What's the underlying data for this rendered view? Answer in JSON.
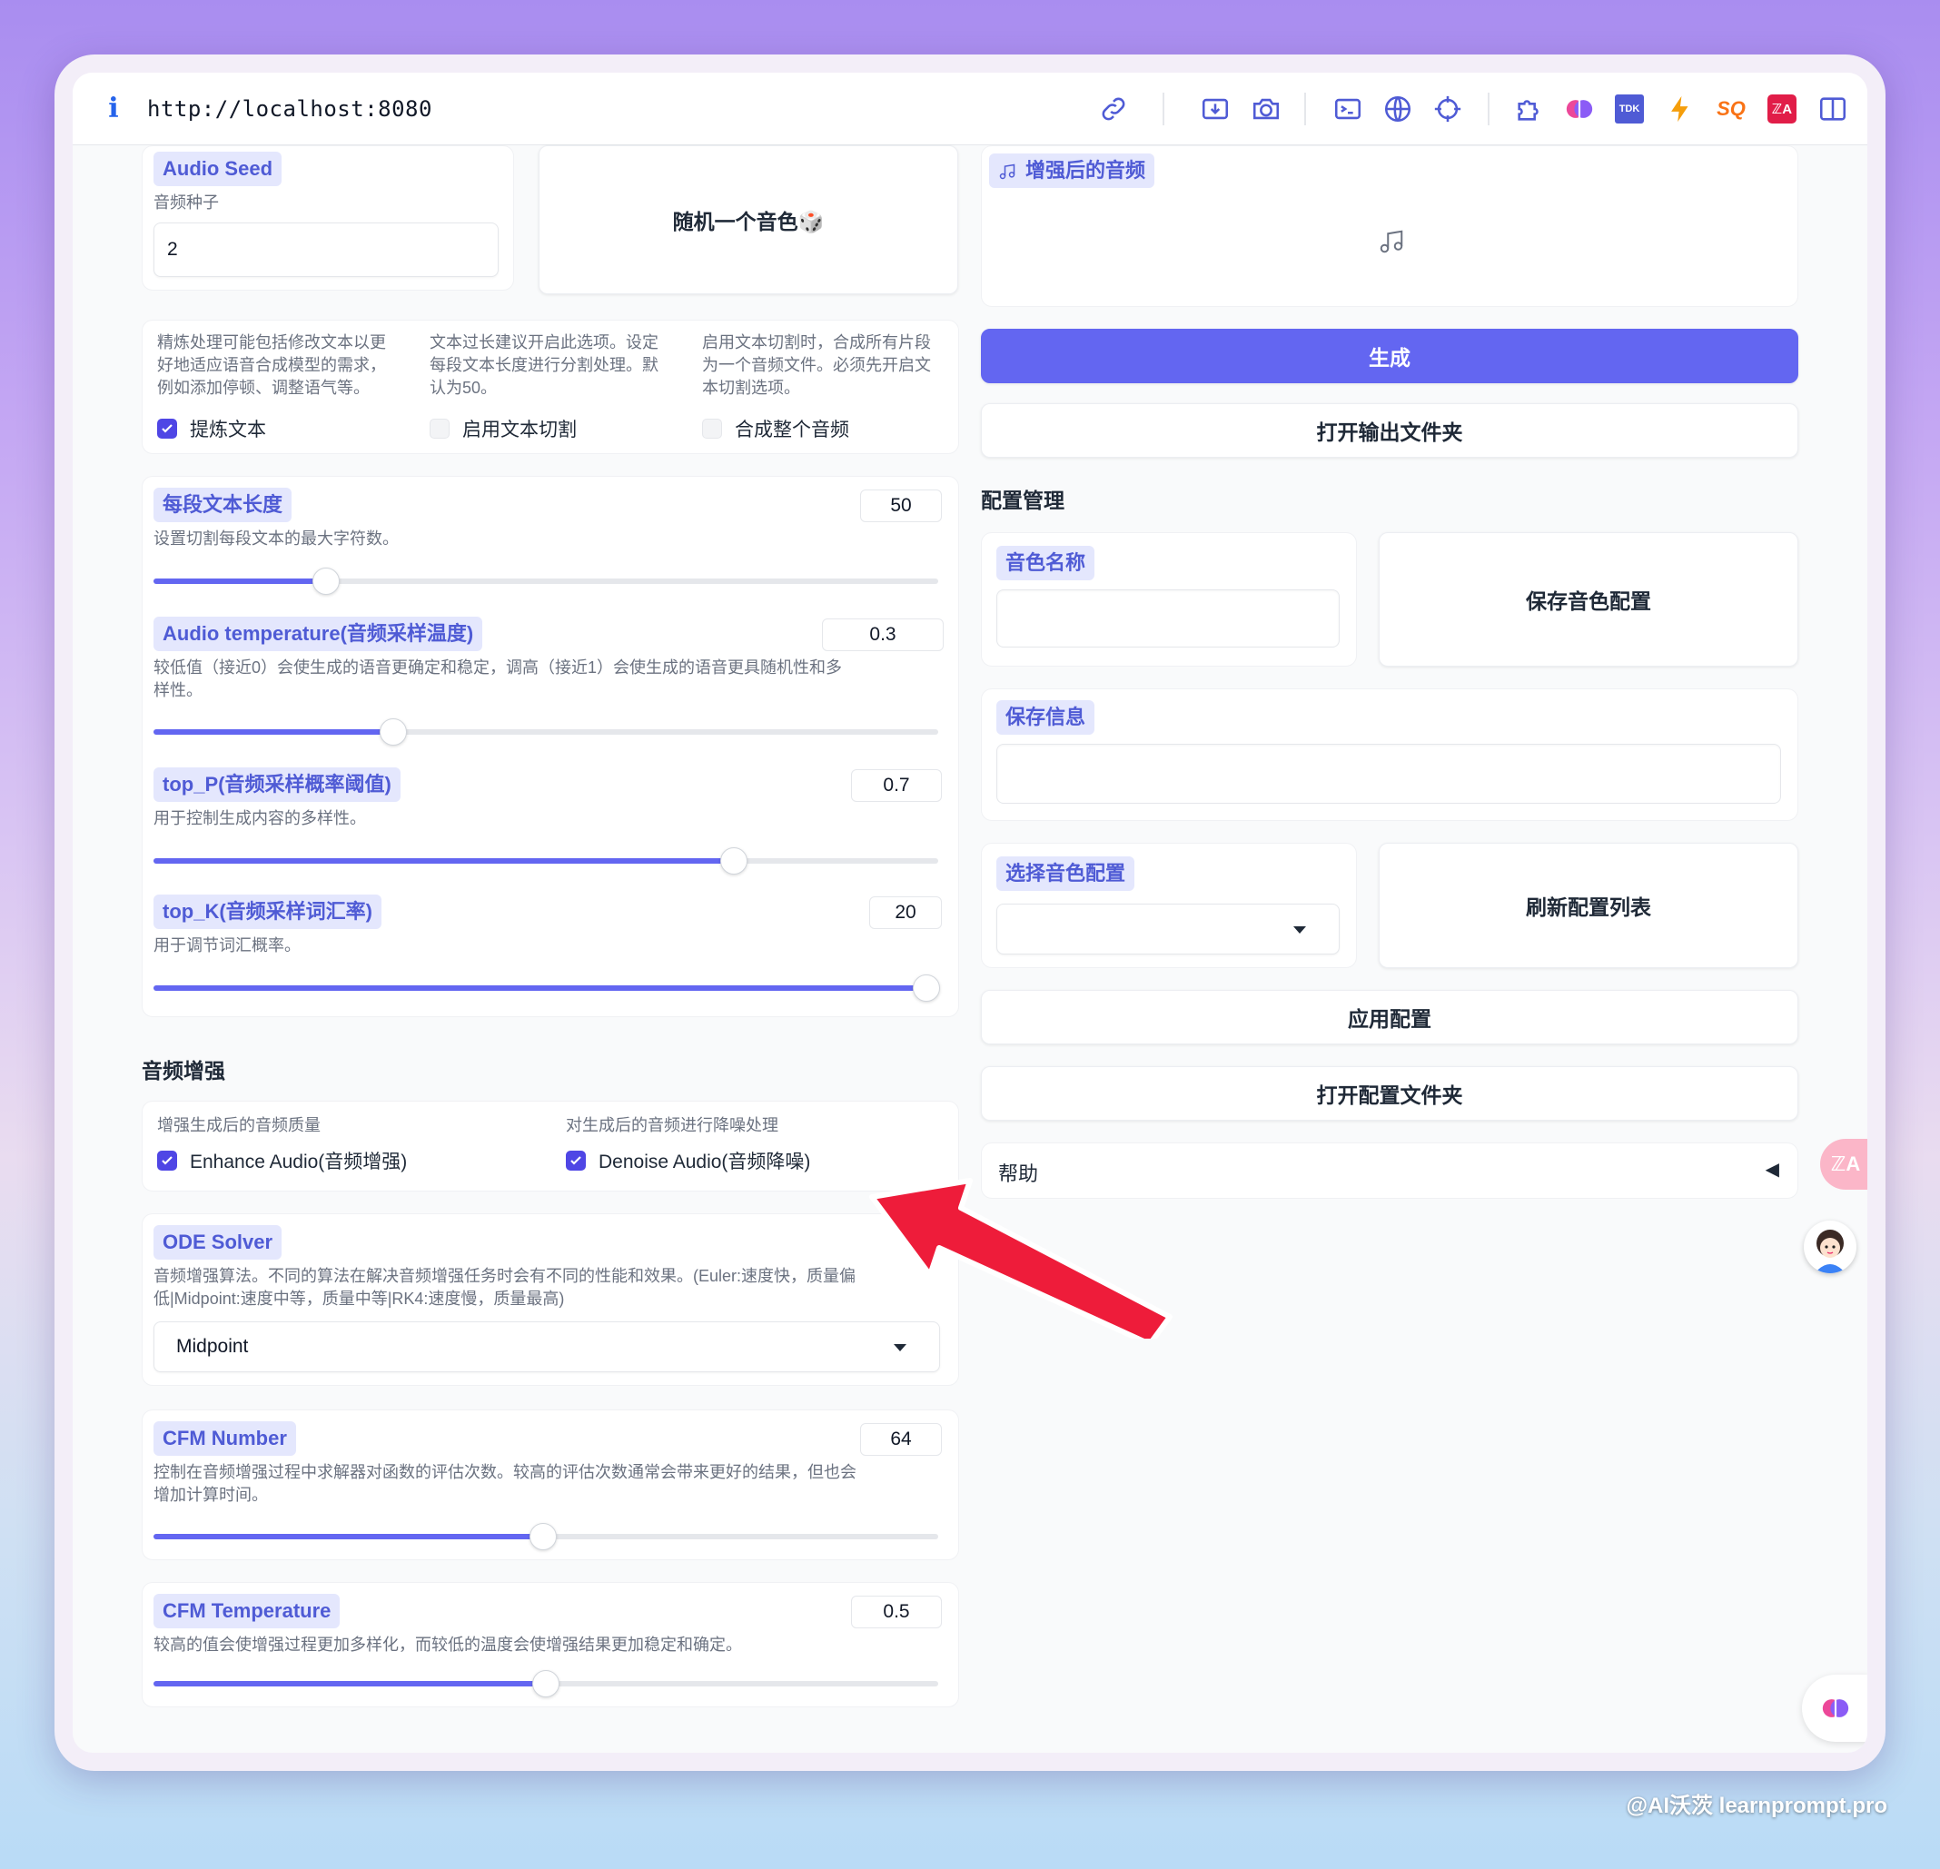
{
  "browser": {
    "info_glyph": "i",
    "url": "http://localhost:8080"
  },
  "toolbar_icons": [
    "link-icon",
    "screenshot-icon",
    "camera-icon",
    "terminal-icon",
    "globe-icon",
    "crosshair-icon",
    "puzzle-icon",
    "brain-icon",
    "tdk-icon",
    "bolt-icon",
    "seo-icon",
    "translate-icon",
    "sidebar-icon"
  ],
  "toolbar_labels": {
    "tdk": "TDK",
    "seo": "SQ",
    "translate": "ℤA"
  },
  "left": {
    "audio_seed": {
      "label": "Audio Seed",
      "desc": "音频种子",
      "value": "2"
    },
    "random_button": "随机一个音色🎲",
    "options": {
      "refine": {
        "desc": "精炼处理可能包括修改文本以更好地适应语音合成模型的需求，例如添加停顿、调整语气等。",
        "label": "提炼文本",
        "checked": true
      },
      "split": {
        "desc": "文本过长建议开启此选项。设定每段文本长度进行分割处理。默认为50。",
        "label": "启用文本切割",
        "checked": false
      },
      "merge": {
        "desc": "启用文本切割时，合成所有片段为一个音频文件。必须先开启文本切割选项。",
        "label": "合成整个音频",
        "checked": false
      }
    },
    "sliders": [
      {
        "label": "每段文本长度",
        "desc": "设置切割每段文本的最大字符数。",
        "value": "50",
        "fraction": 0.22
      },
      {
        "label": "Audio temperature(音频采样温度)",
        "desc": "较低值（接近0）会使生成的语音更确定和稳定，调高（接近1）会使生成的语音更具随机性和多样性。",
        "value": "0.3",
        "fraction": 0.305
      },
      {
        "label": "top_P(音频采样概率阈值)",
        "desc": "用于控制生成内容的多样性。",
        "value": "0.7",
        "fraction": 0.74
      },
      {
        "label": "top_K(音频采样词汇率)",
        "desc": "用于调节词汇概率。",
        "value": "20",
        "fraction": 0.985
      }
    ],
    "enhance_section": "音频增强",
    "enhance": {
      "desc": "增强生成后的音频质量",
      "label": "Enhance Audio(音频增强)",
      "checked": true
    },
    "denoise": {
      "desc": "对生成后的音频进行降噪处理",
      "label": "Denoise Audio(音频降噪)",
      "checked": true
    },
    "ode_solver": {
      "label": "ODE Solver",
      "desc": "音频增强算法。不同的算法在解决音频增强任务时会有不同的性能和效果。(Euler:速度快，质量偏低|Midpoint:速度中等，质量中等|RK4:速度慢，质量最高)",
      "value": "Midpoint"
    },
    "cfm_number": {
      "label": "CFM Number",
      "desc": "控制在音频增强过程中求解器对函数的评估次数。较高的评估次数通常会带来更好的结果，但也会增加计算时间。",
      "value": "64",
      "fraction": 0.497
    },
    "cfm_temperature": {
      "label": "CFM Temperature",
      "desc": "较高的值会使增强过程更加多样化，而较低的温度会使增强结果更加稳定和确定。",
      "value": "0.5",
      "fraction": 0.5
    }
  },
  "right": {
    "enhanced_audio_label": "增强后的音频",
    "generate_button": "生成",
    "open_output_button": "打开输出文件夹",
    "config_section": "配置管理",
    "voice_name_label": "音色名称",
    "voice_name_value": "",
    "save_voice_button": "保存音色配置",
    "save_info_label": "保存信息",
    "save_info_value": "",
    "select_config_label": "选择音色配置",
    "select_config_value": "",
    "refresh_button": "刷新配置列表",
    "apply_button": "应用配置",
    "open_config_button": "打开配置文件夹",
    "help_label": "帮助",
    "help_toggle": "◀"
  },
  "floating": {
    "translate_badge": "ℤA"
  },
  "colors": {
    "accent": "#6366f1",
    "tag_bg": "#e4e7fd",
    "tag_text": "#4f5bd5",
    "arrow": "#ee1c3a"
  },
  "watermark": "@AI沃茨 learnprompt.pro"
}
